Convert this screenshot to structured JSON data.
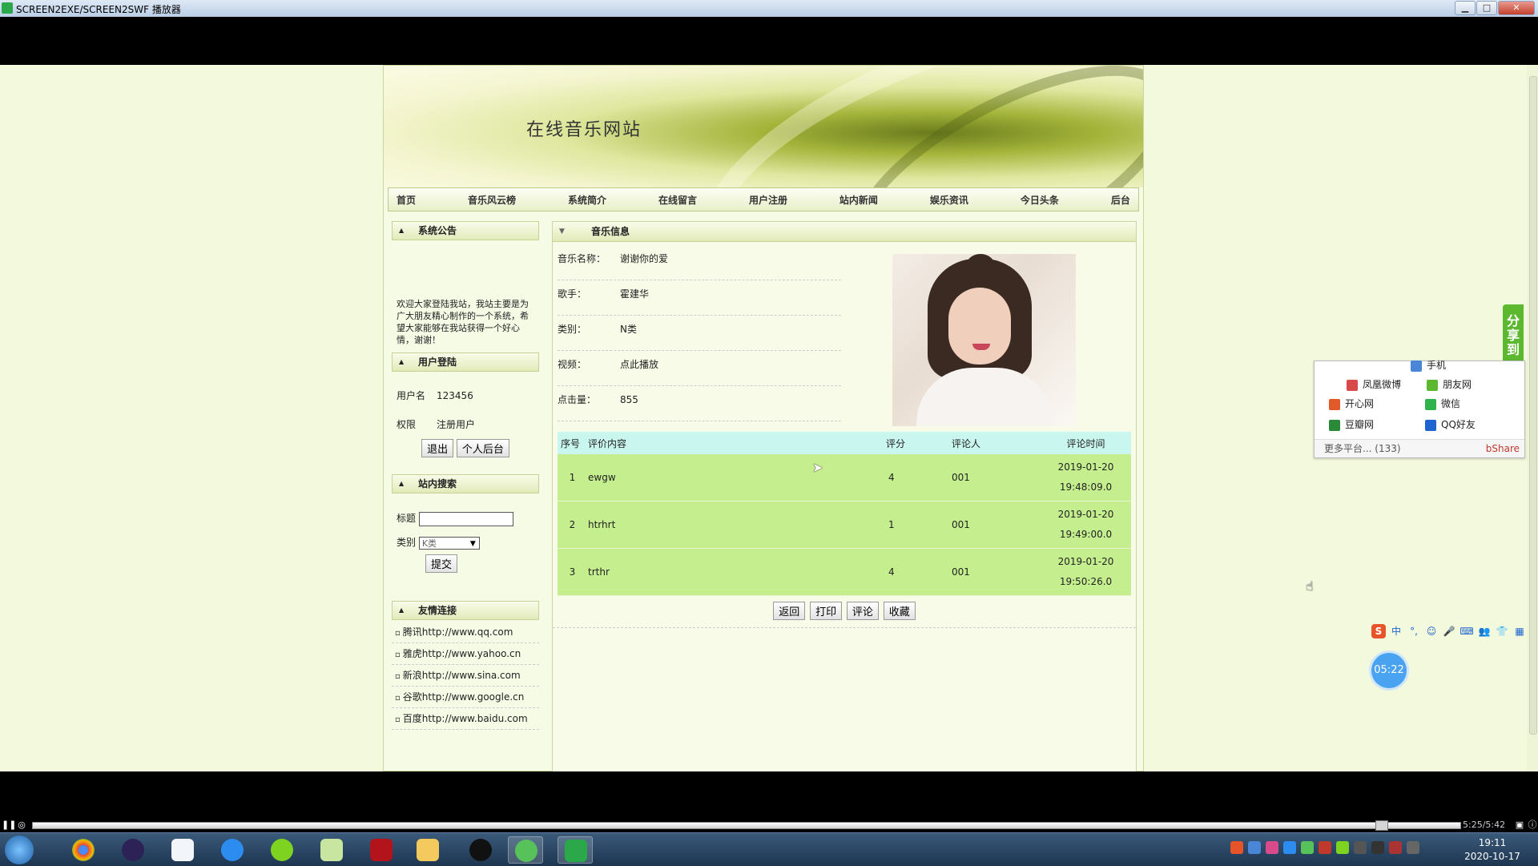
{
  "window": {
    "title": "SCREEN2EXE/SCREEN2SWF 播放器",
    "min": "▁",
    "max": "□",
    "close": "✕"
  },
  "site": {
    "title": "在线音乐网站",
    "nav": [
      "首页",
      "音乐风云榜",
      "系统简介",
      "在线留言",
      "用户注册",
      "站内新闻",
      "娱乐资讯",
      "今日头条",
      "后台"
    ]
  },
  "sidebar": {
    "notice": {
      "heading": "系统公告",
      "text": "欢迎大家登陆我站，我站主要是为广大朋友精心制作的一个系统，希望大家能够在我站获得一个好心情，谢谢！"
    },
    "login": {
      "heading": "用户登陆",
      "username_label": "用户名",
      "username": "123456",
      "role_label": "权限",
      "role": "注册用户",
      "logout": "退出",
      "personal": "个人后台"
    },
    "search": {
      "heading": "站内搜索",
      "title_label": "标题",
      "title_value": "",
      "category_label": "类别",
      "category_value": "K类",
      "submit": "提交"
    },
    "links": {
      "heading": "友情连接",
      "items": [
        "腾讯http://www.qq.com",
        "雅虎http://www.yahoo.cn",
        "新浪http://www.sina.com",
        "谷歌http://www.google.cn",
        "百度http://www.baidu.com"
      ]
    }
  },
  "music": {
    "heading": "音乐信息",
    "fields": [
      {
        "label": "音乐名称：",
        "value": "谢谢你的爱"
      },
      {
        "label": "歌手：",
        "value": "霍建华"
      },
      {
        "label": "类别：",
        "value": "N类"
      },
      {
        "label": "视频：",
        "value": "点此播放"
      },
      {
        "label": "点击量：",
        "value": "855"
      }
    ],
    "comments": {
      "headers": [
        "序号",
        "评价内容",
        "评分",
        "评论人",
        "评论时间"
      ],
      "rows": [
        {
          "no": "1",
          "content": "ewgw",
          "score": "4",
          "user": "001",
          "date": "2019-01-20",
          "time": "19:48:09.0"
        },
        {
          "no": "2",
          "content": "htrhrt",
          "score": "1",
          "user": "001",
          "date": "2019-01-20",
          "time": "19:49:00.0"
        },
        {
          "no": "3",
          "content": "trthr",
          "score": "4",
          "user": "001",
          "date": "2019-01-20",
          "time": "19:50:26.0"
        }
      ]
    },
    "actions": [
      "返回",
      "打印",
      "评论",
      "收藏"
    ]
  },
  "share": {
    "tab": "分享到",
    "items": [
      "手机",
      "凤凰微博",
      "朋友网",
      "开心网",
      "微信",
      "豆瓣网",
      "QQ好友"
    ],
    "more": "更多平台... (133)",
    "brand": "bShare"
  },
  "ime": {
    "items": [
      "S",
      "中",
      "°,",
      "☺",
      "🎤",
      "⌨",
      "👥",
      "👕",
      "▦"
    ]
  },
  "timer": "05:22",
  "player": {
    "time": "5:25/5:42",
    "progress": 0.945
  },
  "clock": {
    "time": "19:11",
    "date": "2020-10-17"
  },
  "colors": {
    "page_bg": "#f3f9dc",
    "table_row": "#c5ef8e",
    "table_header": "#c9f6ef",
    "share_green": "#5cb82f"
  }
}
